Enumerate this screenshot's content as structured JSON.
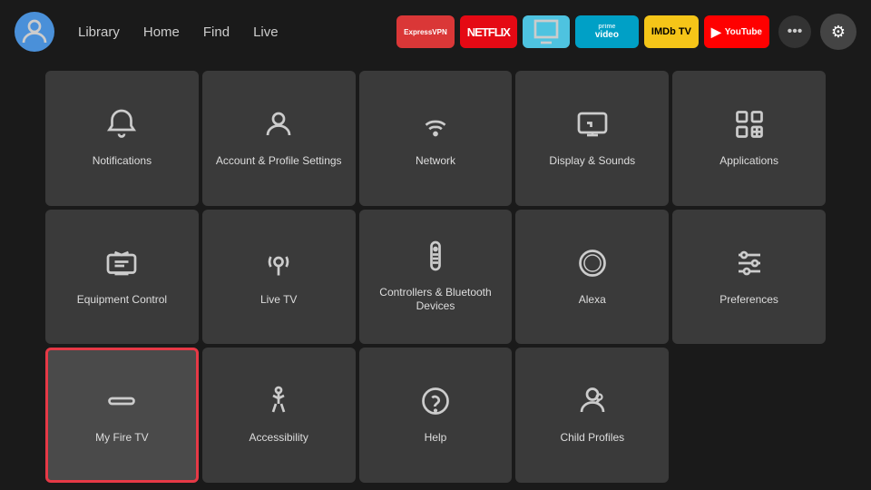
{
  "nav": {
    "links": [
      "Library",
      "Home",
      "Find",
      "Live"
    ],
    "apps": [
      {
        "label": "ExpressVPN",
        "class": "expressvpn"
      },
      {
        "label": "NETFLIX",
        "class": "netflix"
      },
      {
        "label": "↑",
        "class": "amazon"
      },
      {
        "label": "prime video",
        "class": "primevideo"
      },
      {
        "label": "IMDb TV",
        "class": "imdb"
      },
      {
        "label": "▶ YouTube",
        "class": "youtube"
      }
    ],
    "more_label": "•••",
    "settings_label": "⚙"
  },
  "grid": {
    "items": [
      {
        "id": "notifications",
        "label": "Notifications",
        "icon": "bell",
        "selected": false
      },
      {
        "id": "account",
        "label": "Account & Profile Settings",
        "icon": "person",
        "selected": false
      },
      {
        "id": "network",
        "label": "Network",
        "icon": "wifi",
        "selected": false
      },
      {
        "id": "display-sounds",
        "label": "Display & Sounds",
        "icon": "display",
        "selected": false
      },
      {
        "id": "applications",
        "label": "Applications",
        "icon": "apps",
        "selected": false
      },
      {
        "id": "equipment",
        "label": "Equipment Control",
        "icon": "tv",
        "selected": false
      },
      {
        "id": "livetv",
        "label": "Live TV",
        "icon": "antenna",
        "selected": false
      },
      {
        "id": "controllers",
        "label": "Controllers & Bluetooth Devices",
        "icon": "remote",
        "selected": false
      },
      {
        "id": "alexa",
        "label": "Alexa",
        "icon": "alexa",
        "selected": false
      },
      {
        "id": "preferences",
        "label": "Preferences",
        "icon": "sliders",
        "selected": false
      },
      {
        "id": "myfiretv",
        "label": "My Fire TV",
        "icon": "firetv",
        "selected": true
      },
      {
        "id": "accessibility",
        "label": "Accessibility",
        "icon": "accessibility",
        "selected": false
      },
      {
        "id": "help",
        "label": "Help",
        "icon": "help",
        "selected": false
      },
      {
        "id": "childprofiles",
        "label": "Child Profiles",
        "icon": "child",
        "selected": false
      }
    ]
  }
}
